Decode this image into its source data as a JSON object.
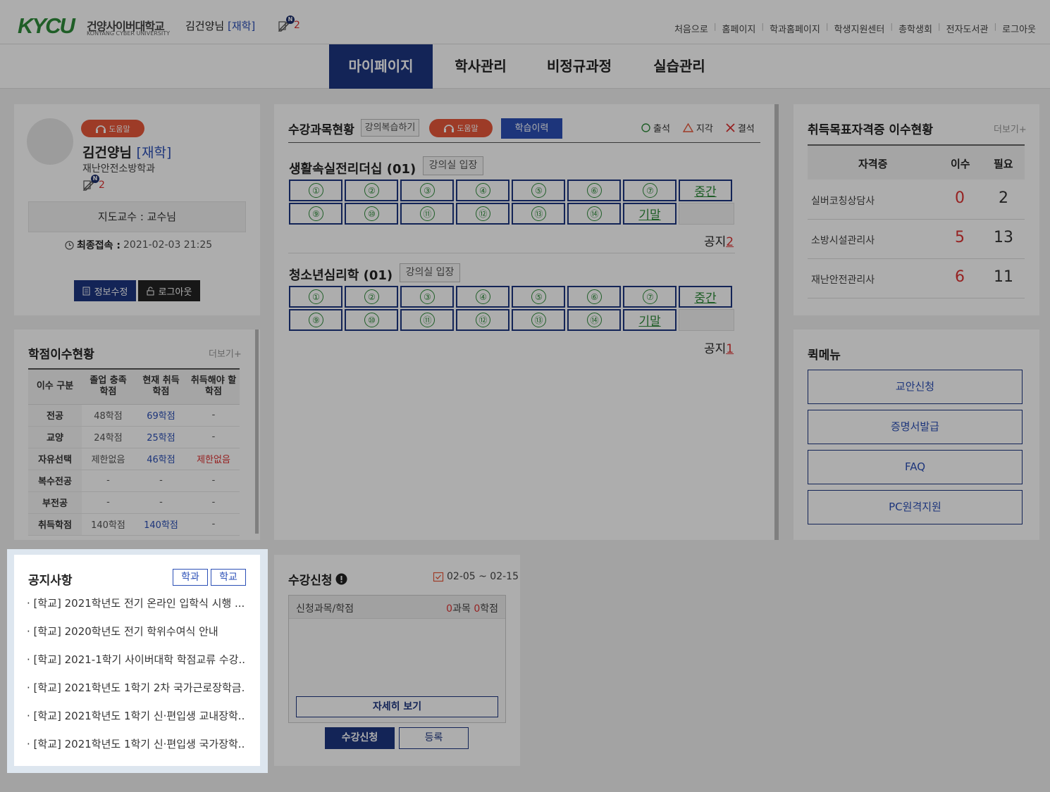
{
  "header": {
    "logo": "KYCU",
    "logo_ko": "건양사이버대학교",
    "logo_en": "KONYANG CYBER UNIVERSITY",
    "user_name": "김건양님",
    "user_status": "[재학]",
    "memo_count": "2",
    "memo_badge": "N",
    "links": [
      "처음으로",
      "홈페이지",
      "학과홈페이지",
      "학생지원센터",
      "총학생회",
      "전자도서관",
      "로그아웃"
    ]
  },
  "nav": {
    "items": [
      "마이페이지",
      "학사관리",
      "비정규과정",
      "실습관리"
    ]
  },
  "profile": {
    "help": "도움말",
    "name": "김건양님",
    "status": "[재학]",
    "dept": "재난안전소방학과",
    "memo_count": "2",
    "advisor": "지도교수 : 교수님",
    "last_login_label": "최종접속 :",
    "last_login_value": "2021-02-03 21:25",
    "edit_btn": "정보수정",
    "logout_btn": "로그아웃"
  },
  "credits": {
    "title": "학점이수현황",
    "more": "더보기+",
    "headers": [
      "이수 구분",
      "졸업 충족\n학점",
      "현재 취득\n학점",
      "취득해야 할\n학점"
    ],
    "rows": [
      [
        "전공",
        "48학점",
        "69학점",
        "-"
      ],
      [
        "교양",
        "24학점",
        "25학점",
        "-"
      ],
      [
        "자유선택",
        "제한없음",
        "46학점",
        "제한없음"
      ],
      [
        "복수전공",
        "-",
        "-",
        "-"
      ],
      [
        "부전공",
        "-",
        "-",
        "-"
      ],
      [
        "취득학점",
        "140학점",
        "140학점",
        "-"
      ]
    ]
  },
  "notice": {
    "title": "공지사항",
    "tab_dept": "학과",
    "tab_school": "학교",
    "items": [
      "· [학교] 2021학년도 전기 온라인 입학식 시행 ...",
      "· [학교] 2020학년도 전기 학위수여식 안내",
      "· [학교] 2021-1학기 사이버대학 학점교류 수강...",
      "· [학교] 2021학년도 1학기 2차 국가근로장학금...",
      "· [학교] 2021학년도 1학기 신·편입생 교내장학...",
      "· [학교] 2021학년도 1학기 신·편입생 국가장학..."
    ]
  },
  "courses": {
    "title": "수강과목현황",
    "review_btn": "강의복습하기",
    "help": "도움말",
    "history_btn": "학습이력",
    "legend": {
      "attend": "출석",
      "late": "지각",
      "absent": "결석"
    },
    "enter_btn": "강의실 입장",
    "notice_label": "공지",
    "week_labels": [
      "①",
      "②",
      "③",
      "④",
      "⑤",
      "⑥",
      "⑦",
      "⑨",
      "⑩",
      "⑪",
      "⑫",
      "⑬",
      "⑭"
    ],
    "midterm": "중간",
    "final": "기말",
    "list": [
      {
        "name": "생활속실전리더십 (01)",
        "notice_count": "2"
      },
      {
        "name": "청소년심리학 (01)",
        "notice_count": "1"
      }
    ]
  },
  "registration": {
    "title": "수강신청",
    "period": "02-05 ~ 02-15",
    "col_label": "신청과목/학점",
    "subj_count": "0",
    "subj_unit": "과목",
    "credit_count": "0",
    "credit_unit": "학점",
    "detail_btn": "자세히 보기",
    "apply_btn": "수강신청",
    "register_btn": "등록"
  },
  "certs": {
    "title": "취득목표자격증 이수현황",
    "more": "더보기+",
    "headers": [
      "자격증",
      "이수",
      "필요"
    ],
    "rows": [
      [
        "실버코칭상담사",
        "0",
        "2"
      ],
      [
        "소방시설관리사",
        "5",
        "13"
      ],
      [
        "재난안전관리사",
        "6",
        "11"
      ]
    ]
  },
  "quickmenu": {
    "title": "퀵메뉴",
    "items": [
      "교안신청",
      "증명서발급",
      "FAQ",
      "PC원격지원"
    ]
  },
  "colors": {
    "navy": "#1d3680",
    "green": "#2e8b3a",
    "red": "#dd3333",
    "orange": "#e8573a"
  }
}
